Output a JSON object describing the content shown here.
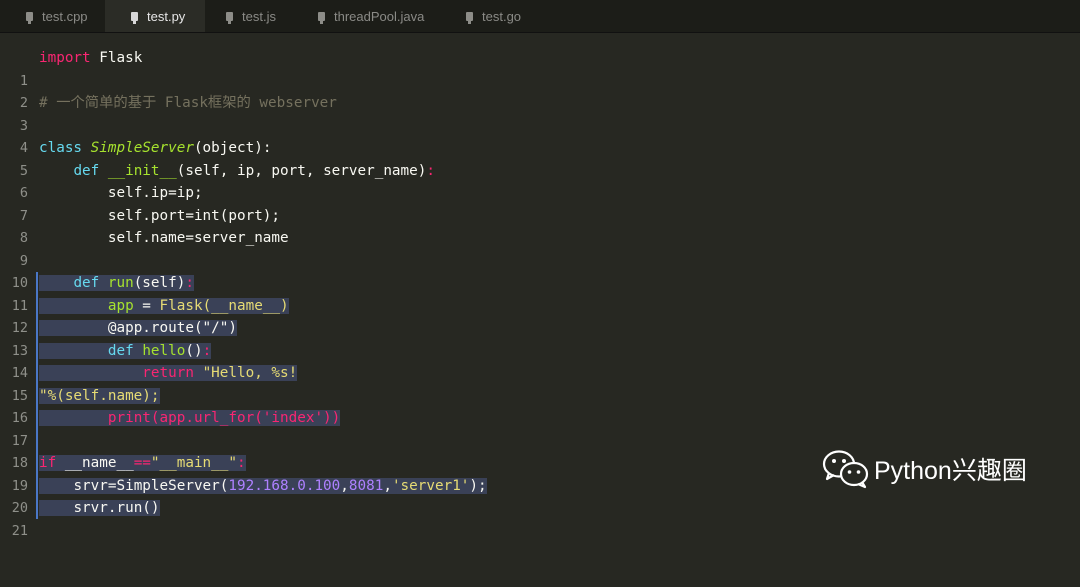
{
  "tabs": [
    {
      "label": "test.cpp",
      "active": false
    },
    {
      "label": "test.py",
      "active": true
    },
    {
      "label": "test.js",
      "active": false
    },
    {
      "label": "threadPool.java",
      "active": false
    },
    {
      "label": "test.go",
      "active": false
    }
  ],
  "line_numbers": [
    "1",
    "2",
    "3",
    "4",
    "5",
    "6",
    "7",
    "8",
    "9",
    "10",
    "11",
    "12",
    "13",
    "14",
    "15",
    "16",
    "17",
    "18",
    "19",
    "20",
    "21"
  ],
  "code": {
    "l1_kw": "import",
    "l1_rest": " Flask",
    "l3": "# 一个简单的基于 Flask框架的 webserver",
    "l5_kw": "class",
    "l5_name": "SimpleServer",
    "l5_rest": "(object):",
    "l6_kw": "def",
    "l6_name": "__init__",
    "l6_rest": "(self, ip, port, server_name)",
    "l6_colon": ":",
    "l7": "self.ip=ip;",
    "l8": "self.port=int(port);",
    "l9": "self.name=server_name",
    "l11_kw": "def",
    "l11_name": "run",
    "l11_rest": "(self)",
    "l11_colon": ":",
    "l12_a": "app",
    "l12_eq": " = ",
    "l12_b": "Flask(__name__)",
    "l13": "@app.route(\"/\")",
    "l14_kw": "def",
    "l14_name": "hello",
    "l14_rest": "()",
    "l14_colon": ":",
    "l15_kw": "return",
    "l15_str": "\"Hello, %s!",
    "l16_str": "\"%(self.name);",
    "l17": "print(app.url_for('index'))",
    "l19_kw": "if",
    "l19_a": " __name__",
    "l19_op": "==",
    "l19_str": "\"__main__\"",
    "l19_colon": ":",
    "l20_a": "srvr=SimpleServer(",
    "l20_n1": "192.168.0.100",
    "l20_c": ",",
    "l20_n2": "8081",
    "l20_c2": ",",
    "l20_s": "'server1'",
    "l20_end": ");",
    "l21": "srvr.run()"
  },
  "watermark": {
    "text": "Python兴趣圈",
    "icon": "wechat-icon"
  },
  "colors": {
    "background": "#272822",
    "keyword": "#f92672",
    "function": "#a6e22e",
    "string": "#e6db74",
    "number": "#ae81ff",
    "comment": "#75715e",
    "selection": "#3a4157"
  }
}
